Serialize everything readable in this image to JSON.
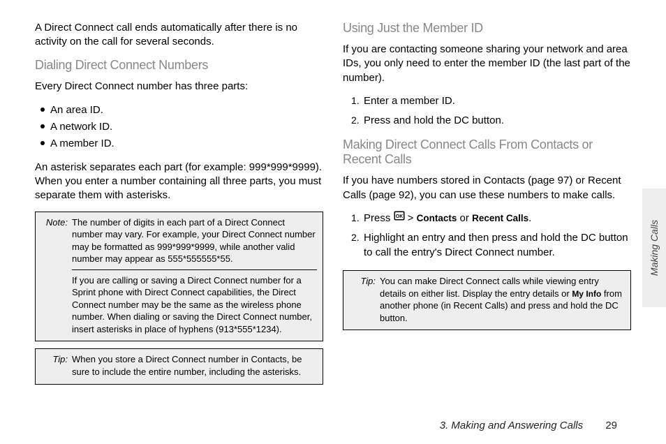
{
  "left": {
    "intro": "A Direct Connect call ends automatically after there is no activity on the call for several seconds.",
    "heading1": "Dialing Direct Connect Numbers",
    "p1": "Every Direct Connect number has three parts:",
    "bullets": [
      "An area ID.",
      "A network ID.",
      "A member ID."
    ],
    "p2": "An asterisk separates each part (for example: 999*999*9999). When you enter a number containing all three parts, you must separate them with asterisks.",
    "note": {
      "label": "Note:",
      "text1": "The number of digits in each part of a Direct Connect number may vary. For example, your Direct Connect number may be formatted as 999*999*9999, while another valid number may appear as 555*555555*55.",
      "text2": "If you are calling or saving a Direct Connect number for a Sprint phone with Direct Connect capabilities, the Direct Connect number may be the same as the wireless phone number. When dialing or saving the Direct Connect number, insert asterisks in place of hyphens (913*555*1234)."
    },
    "tip": {
      "label": "Tip:",
      "text": "When you store a Direct Connect number in Contacts, be sure to include the entire number, including the asterisks."
    }
  },
  "right": {
    "heading1": "Using Just the Member ID",
    "p1": "If you are contacting someone sharing your network and area IDs, you only need to enter the member ID (the last part of the number).",
    "steps1": [
      "Enter a member ID.",
      "Press and hold the DC button."
    ],
    "heading2": "Making Direct Connect Calls From Contacts or Recent Calls",
    "p2": "If you have numbers stored in Contacts (page 97) or Recent Calls (page 92), you can use these numbers to make calls.",
    "step2a_prefix": "Press ",
    "step2a_gt": " > ",
    "step2a_contacts": "Contacts",
    "step2a_or": " or ",
    "step2a_recent": "Recent Calls",
    "step2a_suffix": ".",
    "step2b": "Highlight an entry and then press and hold the DC button to call the entry's Direct Connect number.",
    "tip": {
      "label": "Tip:",
      "text_pre": "You can make Direct Connect calls while viewing entry details on either list. Display the entry details or ",
      "myinfo": "My Info",
      "text_post": " from another phone (in Recent Calls) and press and hold the DC button."
    }
  },
  "sidebar": "Making Calls",
  "footer": {
    "section": "3. Making and Answering Calls",
    "page": "29"
  }
}
